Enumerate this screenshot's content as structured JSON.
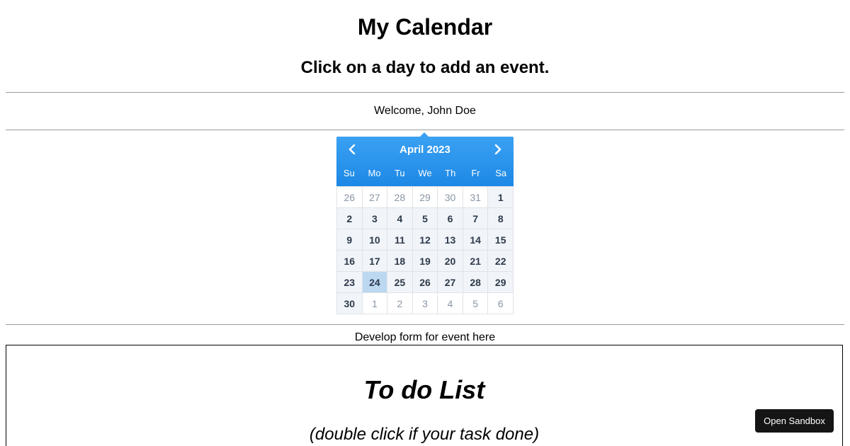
{
  "header": {
    "title": "My Calendar",
    "subtitle": "Click on a day to add an event."
  },
  "welcome": "Welcome, John Doe",
  "calendar": {
    "month_label": "April 2023",
    "prev_icon": "chevron-left-icon",
    "next_icon": "chevron-right-icon",
    "weekdays": [
      "Su",
      "Mo",
      "Tu",
      "We",
      "Th",
      "Fr",
      "Sa"
    ],
    "selected_day": "24",
    "accent_color": "#1d88e5",
    "selected_color": "#bcd8f1",
    "weeks": [
      [
        {
          "d": "26",
          "o": true
        },
        {
          "d": "27",
          "o": true
        },
        {
          "d": "28",
          "o": true
        },
        {
          "d": "29",
          "o": true
        },
        {
          "d": "30",
          "o": true
        },
        {
          "d": "31",
          "o": true
        },
        {
          "d": "1",
          "o": false
        }
      ],
      [
        {
          "d": "2",
          "o": false
        },
        {
          "d": "3",
          "o": false
        },
        {
          "d": "4",
          "o": false
        },
        {
          "d": "5",
          "o": false
        },
        {
          "d": "6",
          "o": false
        },
        {
          "d": "7",
          "o": false
        },
        {
          "d": "8",
          "o": false
        }
      ],
      [
        {
          "d": "9",
          "o": false
        },
        {
          "d": "10",
          "o": false
        },
        {
          "d": "11",
          "o": false
        },
        {
          "d": "12",
          "o": false
        },
        {
          "d": "13",
          "o": false
        },
        {
          "d": "14",
          "o": false
        },
        {
          "d": "15",
          "o": false
        }
      ],
      [
        {
          "d": "16",
          "o": false
        },
        {
          "d": "17",
          "o": false
        },
        {
          "d": "18",
          "o": false
        },
        {
          "d": "19",
          "o": false
        },
        {
          "d": "20",
          "o": false
        },
        {
          "d": "21",
          "o": false
        },
        {
          "d": "22",
          "o": false
        }
      ],
      [
        {
          "d": "23",
          "o": false
        },
        {
          "d": "24",
          "o": false
        },
        {
          "d": "25",
          "o": false
        },
        {
          "d": "26",
          "o": false
        },
        {
          "d": "27",
          "o": false
        },
        {
          "d": "28",
          "o": false
        },
        {
          "d": "29",
          "o": false
        }
      ],
      [
        {
          "d": "30",
          "o": false
        },
        {
          "d": "1",
          "o": true
        },
        {
          "d": "2",
          "o": true
        },
        {
          "d": "3",
          "o": true
        },
        {
          "d": "4",
          "o": true
        },
        {
          "d": "5",
          "o": true
        },
        {
          "d": "6",
          "o": true
        }
      ]
    ]
  },
  "form_note": "Develop form for event here",
  "todo": {
    "title": "To do List",
    "subtitle": "(double click if your task done)"
  },
  "sandbox_button": "Open Sandbox"
}
